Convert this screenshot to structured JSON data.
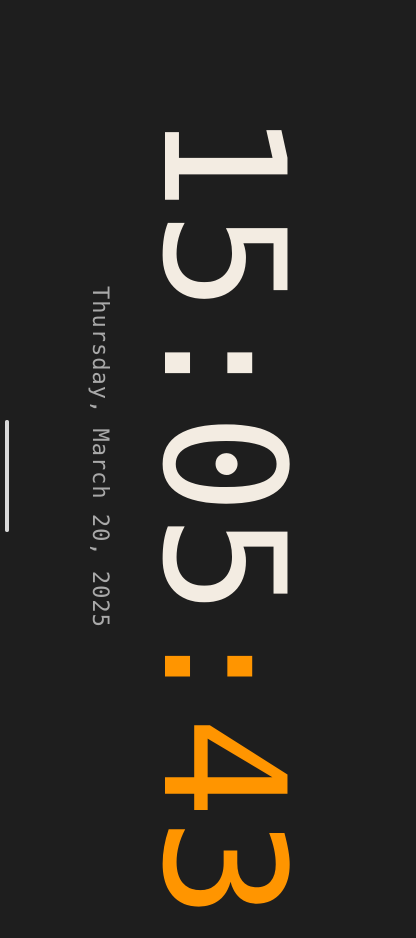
{
  "clock": {
    "hours": "15",
    "sep1": ":",
    "minutes": "05",
    "sep2": ":",
    "seconds": "43",
    "date": "Thursday, March 20, 2025"
  },
  "colors": {
    "background": "#1e1e1e",
    "time": "#f3ece2",
    "seconds_accent": "#ff9500",
    "date": "#a9a9a9",
    "home_indicator": "#d9d9d9"
  }
}
